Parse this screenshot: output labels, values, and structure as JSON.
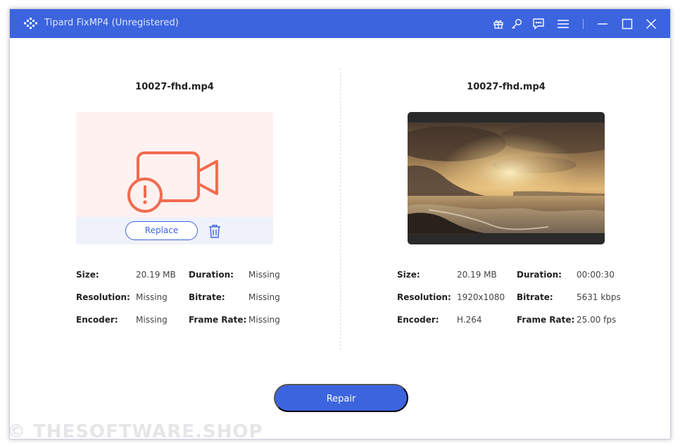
{
  "window": {
    "title": "Tipard FixMP4 (Unregistered)",
    "accent_color": "#3c64df",
    "titlebar_icons": [
      "gift-icon",
      "key-icon",
      "feedback-icon",
      "menu-icon",
      "minimize-icon",
      "maximize-icon",
      "close-icon"
    ]
  },
  "left_panel": {
    "filename": "10027-fhd.mp4",
    "replace_label": "Replace",
    "info": {
      "size_label": "Size:",
      "size_value": "20.19 MB",
      "duration_label": "Duration:",
      "duration_value": "Missing",
      "resolution_label": "Resolution:",
      "resolution_value": "Missing",
      "bitrate_label": "Bitrate:",
      "bitrate_value": "Missing",
      "encoder_label": "Encoder:",
      "encoder_value": "Missing",
      "framerate_label": "Frame Rate:",
      "framerate_value": "Missing"
    }
  },
  "right_panel": {
    "filename": "10027-fhd.mp4",
    "info": {
      "size_label": "Size:",
      "size_value": "20.19 MB",
      "duration_label": "Duration:",
      "duration_value": "00:00:30",
      "resolution_label": "Resolution:",
      "resolution_value": "1920x1080",
      "bitrate_label": "Bitrate:",
      "bitrate_value": "5631 kbps",
      "encoder_label": "Encoder:",
      "encoder_value": "H.264",
      "framerate_label": "Frame Rate:",
      "framerate_value": "25.00 fps"
    }
  },
  "repair_label": "Repair",
  "watermark": "© THESOFTWARE.SHOP"
}
